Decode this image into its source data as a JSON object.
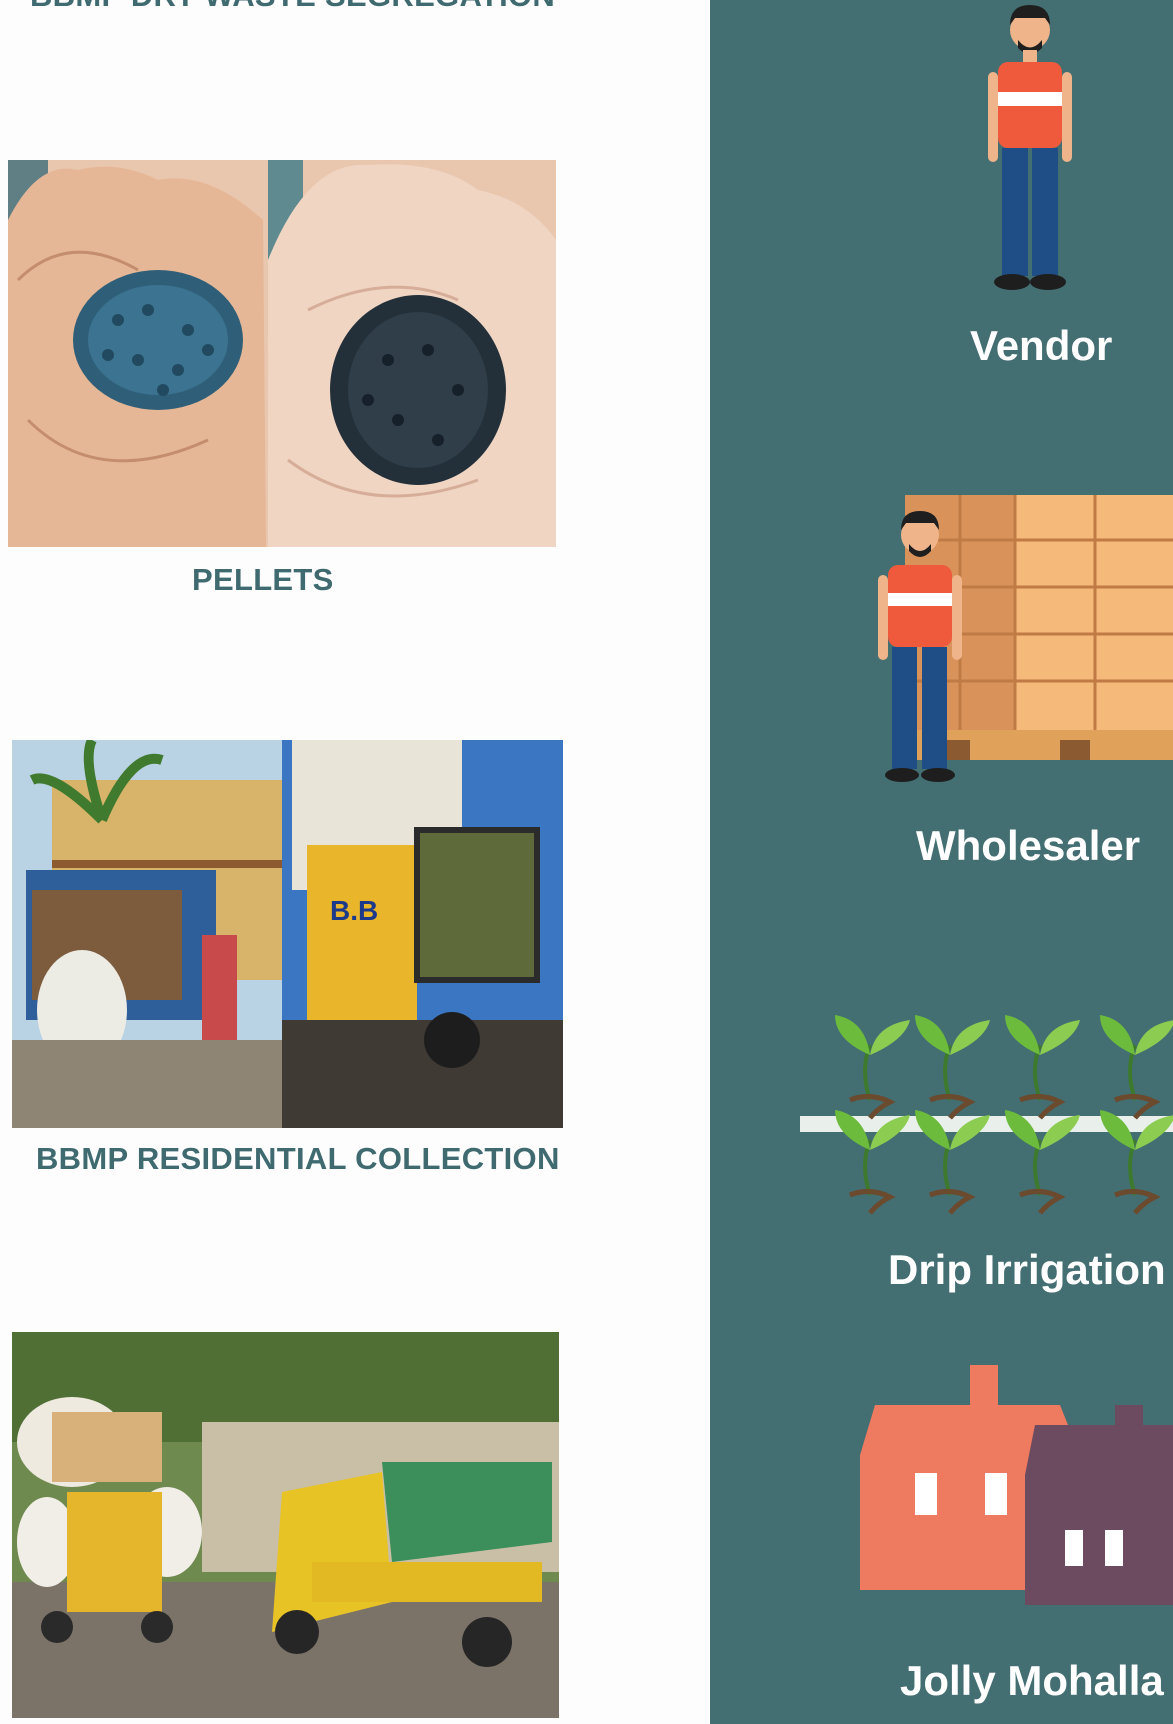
{
  "left": {
    "top_caption": "BBMP DRY WASTE SEGREGATION",
    "sections": [
      {
        "caption": "PELLETS",
        "image": "plastic-pellets-in-hands"
      },
      {
        "caption": "BBMP RESIDENTIAL COLLECTION",
        "image": "collection-trucks"
      },
      {
        "caption": "",
        "image": "auto-collection-vehicles"
      }
    ]
  },
  "right": {
    "items": [
      {
        "label": "Vendor",
        "icon": "vendor-person-icon"
      },
      {
        "label": "Wholesaler",
        "icon": "wholesaler-boxes-icon"
      },
      {
        "label": "Drip Irrigation",
        "icon": "plant-sprouts-icon"
      },
      {
        "label": "Jolly Mohalla",
        "icon": "houses-icon"
      }
    ],
    "colors": {
      "panel": "#436e72",
      "shirt": "#ef5a3c",
      "pants": "#1f4e86",
      "box": "#f5b97a",
      "house_front": "#ee7a60",
      "house_back": "#6c4a5f",
      "leaf": "#6cbb3c"
    }
  }
}
